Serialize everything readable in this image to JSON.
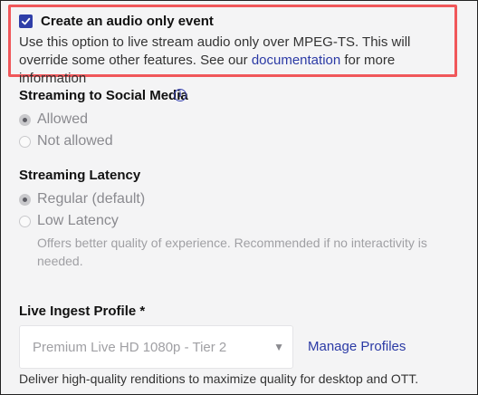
{
  "audio_only": {
    "checked": true,
    "title": "Create an audio only event",
    "desc_before": "Use this option to live stream audio only over MPEG-TS. This will override some other features. See our ",
    "desc_link": "documentation",
    "desc_after": " for more information"
  },
  "social": {
    "label": "Streaming to Social Media",
    "info_glyph": "i",
    "options": [
      {
        "label": "Allowed",
        "selected": true
      },
      {
        "label": "Not allowed",
        "selected": false
      }
    ]
  },
  "latency": {
    "label": "Streaming Latency",
    "options": [
      {
        "label": "Regular (default)",
        "selected": true
      },
      {
        "label": "Low Latency",
        "selected": false
      }
    ],
    "hint": "Offers better quality of experience. Recommended if no interactivity is needed."
  },
  "ingest": {
    "label": "Live Ingest Profile *",
    "selected": "Premium Live HD 1080p - Tier 2",
    "caret": "▼",
    "manage_label": "Manage Profiles",
    "description": "Deliver high-quality renditions to maximize quality for desktop and OTT."
  }
}
